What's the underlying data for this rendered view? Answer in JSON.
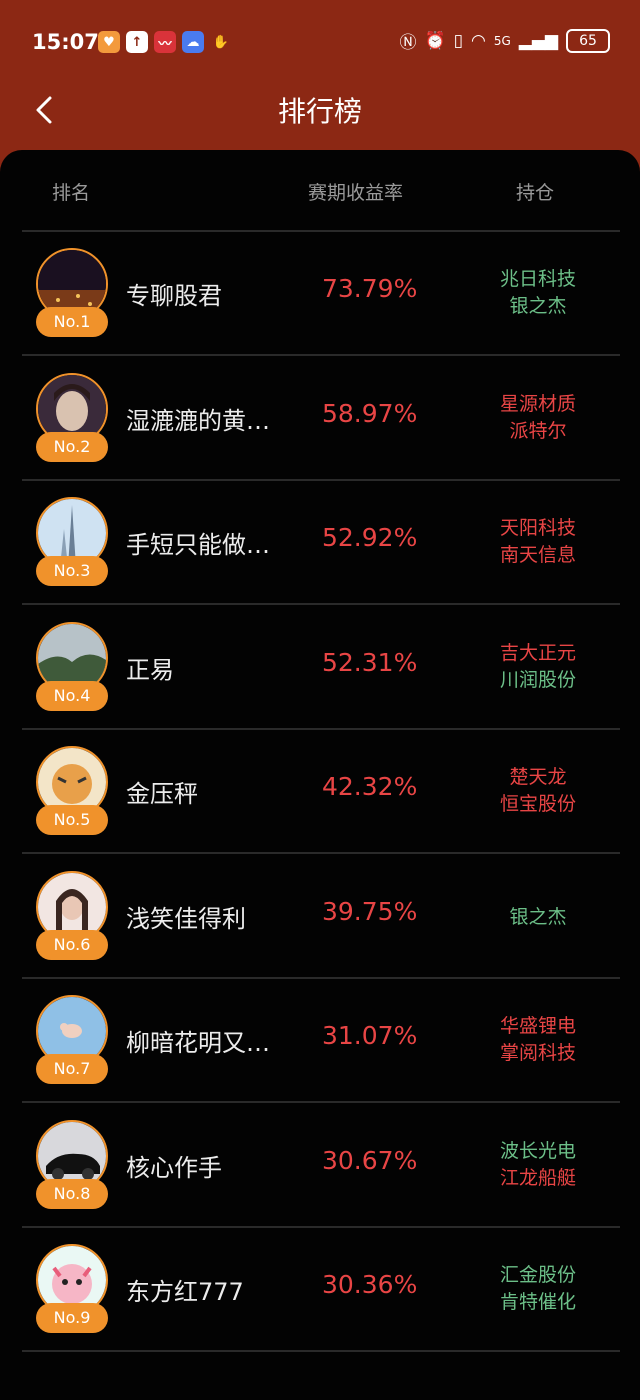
{
  "status": {
    "time": "15:07",
    "battery": "65",
    "network": "5G"
  },
  "header": {
    "title": "排行榜"
  },
  "columns": {
    "rank": "排名",
    "return": "赛期收益率",
    "holdings": "持仓"
  },
  "colors": {
    "header_bg": "#8c2814",
    "badge": "#f0922b",
    "up_red": "#e84545",
    "green": "#6cbf88"
  },
  "rows": [
    {
      "rank": "No.1",
      "name": "专聊股君",
      "rate": "73.79%",
      "holdings": [
        {
          "text": "兆日科技",
          "color": "green"
        },
        {
          "text": "银之杰",
          "color": "green"
        }
      ]
    },
    {
      "rank": "No.2",
      "name": "湿漉漉的黄…",
      "rate": "58.97%",
      "holdings": [
        {
          "text": "星源材质",
          "color": "red"
        },
        {
          "text": "派特尔",
          "color": "red"
        }
      ]
    },
    {
      "rank": "No.3",
      "name": "手短只能做…",
      "rate": "52.92%",
      "holdings": [
        {
          "text": "天阳科技",
          "color": "red"
        },
        {
          "text": "南天信息",
          "color": "red"
        }
      ]
    },
    {
      "rank": "No.4",
      "name": "正易",
      "rate": "52.31%",
      "holdings": [
        {
          "text": "吉大正元",
          "color": "red"
        },
        {
          "text": "川润股份",
          "color": "green"
        }
      ]
    },
    {
      "rank": "No.5",
      "name": "金压秤",
      "rate": "42.32%",
      "holdings": [
        {
          "text": "楚天龙",
          "color": "red"
        },
        {
          "text": "恒宝股份",
          "color": "red"
        }
      ]
    },
    {
      "rank": "No.6",
      "name": "浅笑佳得利",
      "rate": "39.75%",
      "holdings": [
        {
          "text": "银之杰",
          "color": "green"
        }
      ]
    },
    {
      "rank": "No.7",
      "name": "柳暗花明又…",
      "rate": "31.07%",
      "holdings": [
        {
          "text": "华盛锂电",
          "color": "red"
        },
        {
          "text": "掌阅科技",
          "color": "red"
        }
      ]
    },
    {
      "rank": "No.8",
      "name": "核心作手",
      "rate": "30.67%",
      "holdings": [
        {
          "text": "波长光电",
          "color": "green"
        },
        {
          "text": "江龙船艇",
          "color": "red"
        }
      ]
    },
    {
      "rank": "No.9",
      "name": "东方红777",
      "rate": "30.36%",
      "holdings": [
        {
          "text": "汇金股份",
          "color": "green"
        },
        {
          "text": "肯特催化",
          "color": "green"
        }
      ]
    }
  ]
}
